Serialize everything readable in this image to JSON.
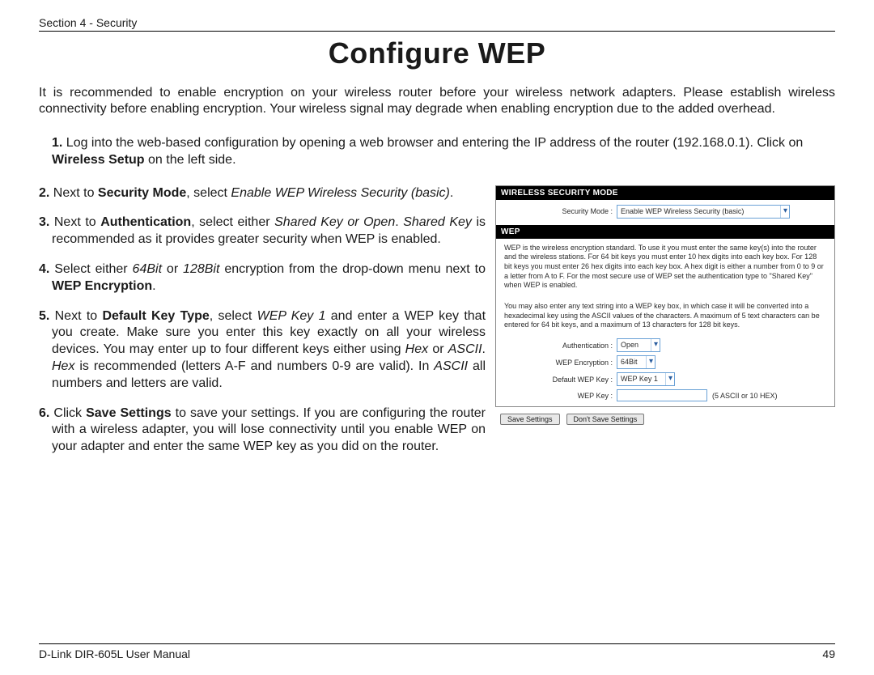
{
  "header": {
    "section": "Section 4 - Security"
  },
  "title": "Configure WEP",
  "intro": "It is recommended to enable encryption on your wireless router before your wireless network adapters. Please establish wireless connectivity before enabling encryption. Your wireless signal may degrade when enabling encryption due to the added overhead.",
  "steps": {
    "s1": {
      "num": "1.",
      "body_a": " Log into the web-based configuration by opening a web browser and entering the IP address of the router (192.168.0.1). Click on ",
      "bold_a": "Wireless Setup",
      "body_b": " on the left side."
    },
    "s2": {
      "num": "2.",
      "body_a": " Next to ",
      "bold_a": "Security Mode",
      "body_b": ", select ",
      "italic_a": "Enable WEP Wireless Security (basic)",
      "body_c": "."
    },
    "s3": {
      "num": "3.",
      "body_a": " Next to ",
      "bold_a": "Authentication",
      "body_b": ", select either ",
      "italic_a": "Shared Key or Open",
      "body_c": ". ",
      "italic_b": "Shared Key",
      "body_d": " is recommended as it provides greater security when WEP is enabled."
    },
    "s4": {
      "num": "4.",
      "body_a": " Select either ",
      "italic_a": "64Bit",
      "body_b": " or ",
      "italic_b": "128Bit",
      "body_c": " encryption from the drop-down menu next to ",
      "bold_a": "WEP Encryption",
      "body_d": "."
    },
    "s5": {
      "num": "5.",
      "body_a": " Next to ",
      "bold_a": "Default Key Type",
      "body_b": ", select ",
      "italic_a": "WEP Key 1",
      "body_c": " and enter a WEP key that you create. Make sure you enter this key exactly on all your wireless devices. You may enter up to four different keys either using ",
      "italic_b": "Hex",
      "body_d": " or ",
      "italic_c": "ASCII",
      "body_e": ". ",
      "italic_d": "Hex",
      "body_f": " is recommended (letters A-F and numbers 0-9 are valid). In ",
      "italic_e": "ASCII",
      "body_g": " all numbers and letters are valid."
    },
    "s6": {
      "num": "6.",
      "body_a": " Click ",
      "bold_a": "Save Settings",
      "body_b": " to save your settings. If you are configuring the router with a wireless adapter, you will lose connectivity until you enable WEP on your adapter and enter the same WEP key as you did on the router."
    }
  },
  "router": {
    "bar1": "WIRELESS SECURITY MODE",
    "secmode_label": "Security Mode :",
    "secmode_value": "Enable WEP Wireless Security (basic)",
    "bar2": "WEP",
    "para1": "WEP is the wireless encryption standard. To use it you must enter the same key(s) into the router and the wireless stations. For 64 bit keys you must enter 10 hex digits into each key box. For 128 bit keys you must enter 26 hex digits into each key box. A hex digit is either a number from 0 to 9 or a letter from A to F. For the most secure use of WEP set the authentication type to \"Shared Key\" when WEP is enabled.",
    "para2": "You may also enter any text string into a WEP key box, in which case it will be converted into a hexadecimal key using the ASCII values of the characters. A maximum of 5 text characters can be entered for 64 bit keys, and a maximum of 13 characters for 128 bit keys.",
    "auth_label": "Authentication :",
    "auth_value": "Open",
    "enc_label": "WEP Encryption :",
    "enc_value": "64Bit",
    "defkey_label": "Default WEP Key :",
    "defkey_value": "WEP Key 1",
    "key_label": "WEP Key :",
    "key_hint": "(5 ASCII or 10 HEX)",
    "btn_save": "Save Settings",
    "btn_dont": "Don't Save Settings"
  },
  "footer": {
    "left": "D-Link DIR-605L User Manual",
    "right": "49"
  }
}
